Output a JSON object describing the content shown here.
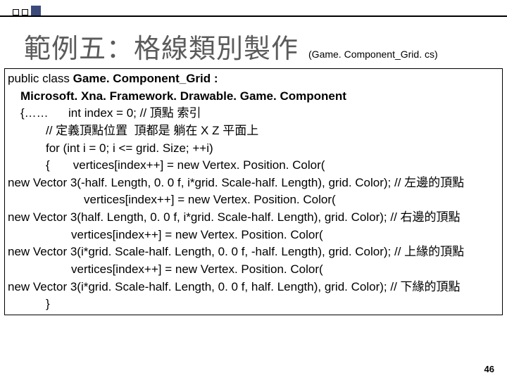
{
  "header": {
    "title": "範例五：格線類別製作",
    "subtitle": "(Game. Component_Grid. cs)"
  },
  "code": {
    "line1a": "public class ",
    "line1b": "Game. Component_Grid :",
    "line2": "Microsoft. Xna. Framework. Drawable. Game. Component",
    "line3": "{……      int index = 0; // 頂點 索引",
    "line4": "// 定義頂點位置  頂都是 躺在 X Z 平面上",
    "line5": "for (int i = 0; i <= grid. Size; ++i)",
    "line6": "{       vertices[index++] = new Vertex. Position. Color(",
    "line7": "new Vector 3(-half. Length, 0. 0 f, i*grid. Scale-half. Length), grid. Color); // 左邊的頂點",
    "line8": "vertices[index++] = new Vertex. Position. Color(",
    "line9": "new Vector 3(half. Length, 0. 0 f, i*grid. Scale-half. Length), grid. Color); // 右邊的頂點",
    "line10": "vertices[index++] = new Vertex. Position. Color(",
    "line11": "new Vector 3(i*grid. Scale-half. Length, 0. 0 f, -half. Length), grid. Color); // 上緣的頂點",
    "line12": "vertices[index++] = new Vertex. Position. Color(",
    "line13": "new Vector 3(i*grid. Scale-half. Length, 0. 0 f, half. Length), grid. Color); // 下緣的頂點",
    "line14": "}"
  },
  "page": "46"
}
